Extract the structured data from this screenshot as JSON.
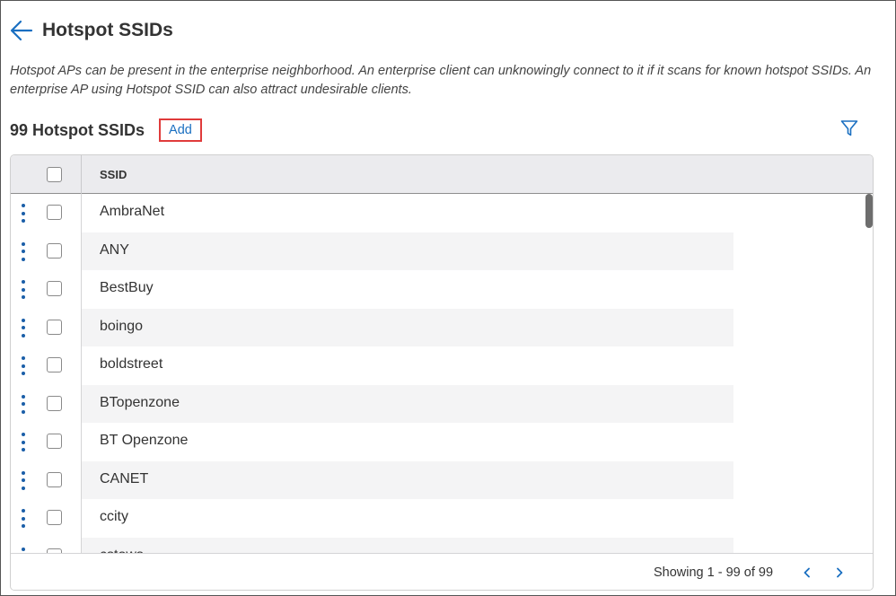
{
  "header": {
    "title": "Hotspot SSIDs",
    "back_icon": "arrow-left-icon"
  },
  "description": "Hotspot APs can be present in the enterprise neighborhood. An enterprise client can unknowingly connect to it if it scans for known hotspot SSIDs. An enterprise AP using Hotspot SSID can also attract undesirable clients.",
  "toolbar": {
    "count_title": "99 Hotspot SSIDs",
    "add_label": "Add",
    "filter_icon": "filter-icon"
  },
  "table": {
    "columns": [
      "SSID"
    ],
    "rows": [
      {
        "ssid": "AmbraNet"
      },
      {
        "ssid": "ANY"
      },
      {
        "ssid": "BestBuy"
      },
      {
        "ssid": "boingo"
      },
      {
        "ssid": "boldstreet"
      },
      {
        "ssid": "BTopenzone"
      },
      {
        "ssid": "BT Openzone"
      },
      {
        "ssid": "CANET"
      },
      {
        "ssid": "ccity"
      },
      {
        "ssid": "cstows"
      }
    ]
  },
  "footer": {
    "showing": "Showing 1 - 99 of 99",
    "prev_icon": "chevron-left-icon",
    "next_icon": "chevron-right-icon"
  },
  "colors": {
    "accent": "#1a6fc1",
    "highlight_border": "#e03b3b",
    "header_bg": "#ebebee",
    "stripe_bg": "#f4f4f5"
  }
}
